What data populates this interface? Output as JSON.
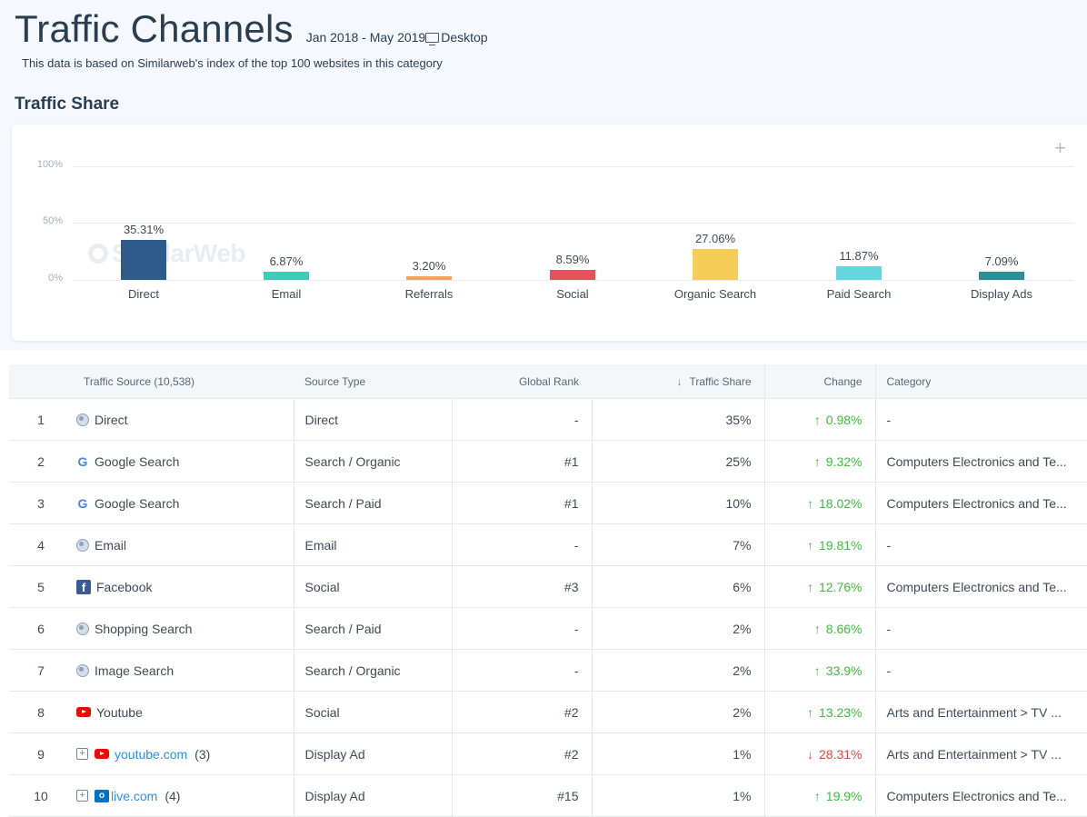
{
  "header": {
    "title": "Traffic Channels",
    "date_range": "Jan 2018 - May 2019",
    "device": "Desktop",
    "subtitle": "This data is based on Similarweb's index of the top 100 websites in this category",
    "section_title": "Traffic Share",
    "watermark": "SimilarWeb",
    "plus_icon": "+"
  },
  "chart_data": {
    "type": "bar",
    "categories": [
      "Direct",
      "Email",
      "Referrals",
      "Social",
      "Organic Search",
      "Paid Search",
      "Display Ads"
    ],
    "values": [
      35.31,
      6.87,
      3.2,
      8.59,
      27.06,
      11.87,
      7.09
    ],
    "labels": [
      "35.31%",
      "6.87%",
      "3.20%",
      "8.59%",
      "27.06%",
      "11.87%",
      "7.09%"
    ],
    "colors": [
      "#2f5b8a",
      "#3fcbb9",
      "#f2a15e",
      "#e8515a",
      "#f7cd59",
      "#62d8de",
      "#2b8f97"
    ],
    "yticks": [
      "100%",
      "50%",
      "0%"
    ],
    "ylim": [
      0,
      100
    ],
    "grid": true
  },
  "table": {
    "headers": {
      "num": "",
      "source": "Traffic Source (10,538)",
      "type": "Source Type",
      "rank": "Global Rank",
      "share": "Traffic Share",
      "change": "Change",
      "category": "Category"
    },
    "sort_icon": "↓",
    "rows": [
      {
        "num": "1",
        "icon": "globe-icon",
        "source": "Direct",
        "type": "Direct",
        "rank": "-",
        "share": "35%",
        "change": "0.98%",
        "dir": "up",
        "category": "-"
      },
      {
        "num": "2",
        "icon": "google-icon",
        "source": "Google Search",
        "type": "Search / Organic",
        "rank": "#1",
        "share": "25%",
        "change": "9.32%",
        "dir": "up",
        "category": "Computers Electronics and Te..."
      },
      {
        "num": "3",
        "icon": "google-icon",
        "source": "Google Search",
        "type": "Search / Paid",
        "rank": "#1",
        "share": "10%",
        "change": "18.02%",
        "dir": "up",
        "category": "Computers Electronics and Te..."
      },
      {
        "num": "4",
        "icon": "globe-icon",
        "source": "Email",
        "type": "Email",
        "rank": "-",
        "share": "7%",
        "change": "19.81%",
        "dir": "up",
        "category": "-"
      },
      {
        "num": "5",
        "icon": "facebook-icon",
        "source": "Facebook",
        "type": "Social",
        "rank": "#3",
        "share": "6%",
        "change": "12.76%",
        "dir": "up",
        "category": "Computers Electronics and Te..."
      },
      {
        "num": "6",
        "icon": "globe-icon",
        "source": "Shopping Search",
        "type": "Search / Paid",
        "rank": "-",
        "share": "2%",
        "change": "8.66%",
        "dir": "up",
        "category": "-"
      },
      {
        "num": "7",
        "icon": "globe-icon",
        "source": "Image Search",
        "type": "Search / Organic",
        "rank": "-",
        "share": "2%",
        "change": "33.9%",
        "dir": "up",
        "category": "-"
      },
      {
        "num": "8",
        "icon": "youtube-icon",
        "source": "Youtube",
        "type": "Social",
        "rank": "#2",
        "share": "2%",
        "change": "13.23%",
        "dir": "up",
        "category": "Arts and Entertainment > TV ..."
      },
      {
        "num": "9",
        "icon": "youtube-icon",
        "source": "youtube.com",
        "count": "(3)",
        "expandable": true,
        "type": "Display Ad",
        "rank": "#2",
        "share": "1%",
        "change": "28.31%",
        "dir": "down",
        "category": "Arts and Entertainment > TV ..."
      },
      {
        "num": "10",
        "icon": "outlook-icon",
        "source": "live.com",
        "count": "(4)",
        "expandable": true,
        "type": "Display Ad",
        "rank": "#15",
        "share": "1%",
        "change": "19.9%",
        "dir": "up",
        "category": "Computers Electronics and Te..."
      }
    ]
  }
}
